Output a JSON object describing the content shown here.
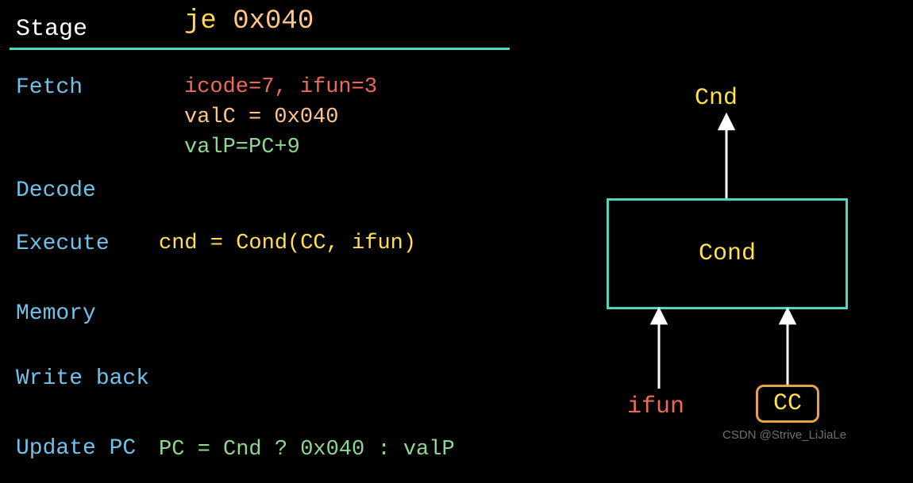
{
  "header": {
    "stage_label": "Stage",
    "instr_mnemonic": "je",
    "instr_addr": "0x040"
  },
  "stages": {
    "fetch": {
      "label": "Fetch",
      "line1": "icode=7, ifun=3",
      "line2": "valC = 0x040",
      "line3": "valP=PC+9"
    },
    "decode": {
      "label": "Decode"
    },
    "execute": {
      "label": "Execute",
      "line1": "cnd = Cond(CC, ifun)"
    },
    "memory": {
      "label": "Memory"
    },
    "write_back": {
      "label": "Write back"
    },
    "update_pc": {
      "label": "Update PC",
      "line1": "PC = Cnd ? 0x040 : valP"
    }
  },
  "diagram": {
    "output_label": "Cnd",
    "block_label": "Cond",
    "input_left": "ifun",
    "input_right": "CC"
  },
  "watermark": "CSDN @Strive_LiJiaLe",
  "colors": {
    "bg": "#000000",
    "teal": "#4fd6c1",
    "cyan": "#6fc3e8",
    "red": "#ed6a5a",
    "peach": "#ffc58a",
    "green": "#8fd88f",
    "yellow": "#ffe04d",
    "orange": "#e6a24a"
  }
}
